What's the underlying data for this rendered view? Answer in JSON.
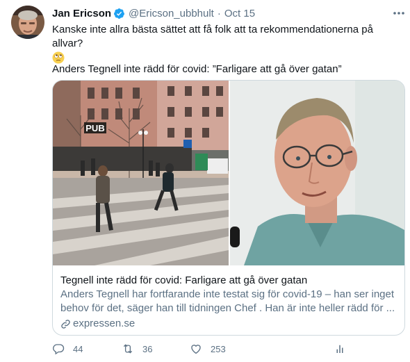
{
  "tweet": {
    "display_name": "Jan Ericson",
    "handle": "@Ericson_ubbhult",
    "separator": "·",
    "date": "Oct 15",
    "text_line1": "Kanske inte allra bästa sättet att få folk att ta rekommendationerna på allvar?",
    "emoji": "face-with-rolling-eyes",
    "quote_line": "Anders Tegnell inte rädd för covid: ”Farligare att gå över gatan”"
  },
  "card": {
    "title": "Tegnell inte rädd för covid: Farligare att gå över gatan",
    "description": "Anders Tegnell har fortfarande inte testat sig för covid-19 – han ser inget behov för det, säger han till tidningen Chef . Han är inte heller rädd för ...",
    "domain": "expressen.se",
    "sign_text": "PUB"
  },
  "actions": {
    "reply_count": "44",
    "retweet_count": "36",
    "like_count": "253"
  },
  "colors": {
    "text_primary": "#0f1419",
    "text_secondary": "#5b7083",
    "verified_blue": "#1da1f2",
    "border": "#cfd9de"
  },
  "icons": {
    "verified": "verified-badge-icon",
    "more": "more-icon",
    "link": "link-icon",
    "reply": "reply-icon",
    "retweet": "retweet-icon",
    "like": "like-icon",
    "share": "share-icon"
  }
}
